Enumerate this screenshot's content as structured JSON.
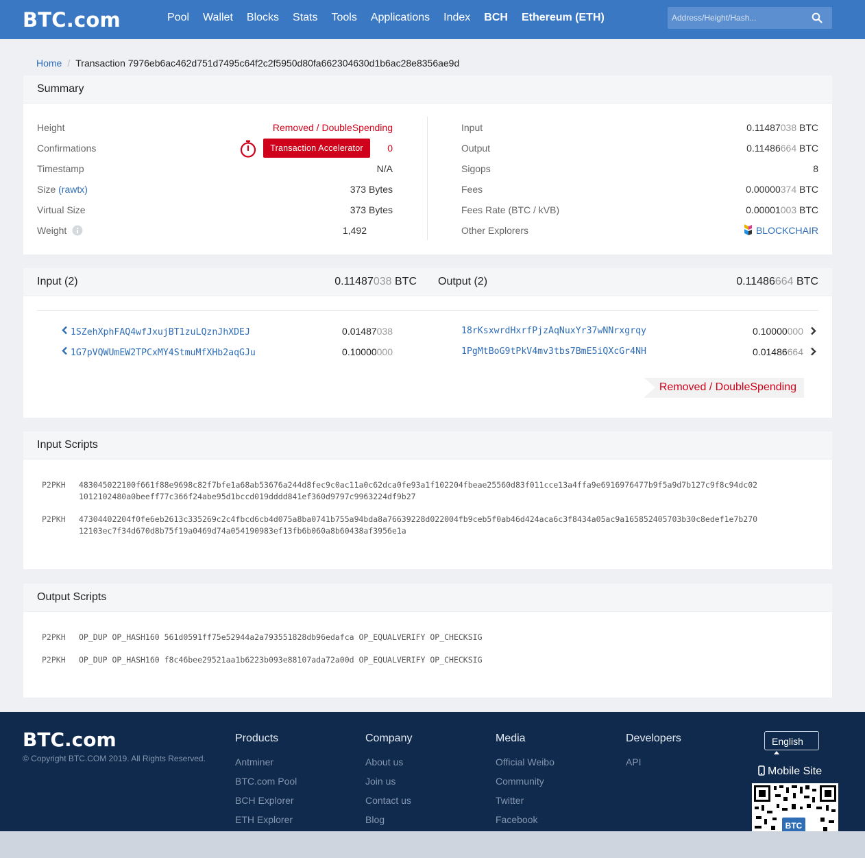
{
  "header": {
    "logo": "BTC.com",
    "nav": [
      "Pool",
      "Wallet",
      "Blocks",
      "Stats",
      "Tools",
      "Applications",
      "Index",
      "BCH",
      "Ethereum (ETH)"
    ],
    "search_placeholder": "Address/Height/Hash..."
  },
  "breadcrumb": {
    "home": "Home",
    "current": "Transaction 7976eb6ac462d751d7495c64f2c2f5950d80fa662304630d1b6ac28e8356ae9d"
  },
  "summary": {
    "title": "Summary",
    "left": [
      {
        "label": "Height",
        "value": "Removed / DoubleSpending"
      },
      {
        "label": "Confirmations",
        "value": "0"
      },
      {
        "label": "Timestamp",
        "value": "N/A"
      },
      {
        "label": "Size",
        "link": "(rawtx)",
        "value": "373 Bytes"
      },
      {
        "label": "Virtual Size",
        "value": "373 Bytes"
      },
      {
        "label": "Weight",
        "value": "1,492"
      }
    ],
    "accelerator_label": "Transaction Accelerator",
    "right": [
      {
        "label": "Input",
        "value_main": "0.11487",
        "value_light": "038",
        "unit": " BTC"
      },
      {
        "label": "Output",
        "value_main": "0.11486",
        "value_light": "664",
        "unit": " BTC"
      },
      {
        "label": "Sigops",
        "value": "8"
      },
      {
        "label": "Fees",
        "value_main": "0.00000",
        "value_light": "374",
        "unit": " BTC"
      },
      {
        "label": "Fees Rate (BTC / kVB)",
        "value_main": "0.00001",
        "value_light": "003",
        "unit": " BTC"
      },
      {
        "label": "Other Explorers",
        "value": "BLOCKCHAIR"
      }
    ]
  },
  "io": {
    "input_title": "Input (2)",
    "input_total_main": "0.11487",
    "input_total_light": "038",
    "output_title": "Output (2)",
    "output_total_main": "0.11486",
    "output_total_light": "664",
    "unit": " BTC",
    "inputs": [
      {
        "address": "1SZehXphFAQ4wfJxujBT1zuLQznJhXDEJ",
        "main": "0.01487",
        "light": "038"
      },
      {
        "address": "1G7pVQWUmEW2TPCxMY4StmuMfXHb2aqGJu",
        "main": "0.10000",
        "light": "000"
      }
    ],
    "outputs": [
      {
        "address": "18rKsxwrdHxrfPjzAqNuxYr37wNNrxgrqy",
        "main": "0.10000",
        "light": "000"
      },
      {
        "address": "1PgMtBoG9tPkV4mv3tbs7BmE5iQXcGr4NH",
        "main": "0.01486",
        "light": "664"
      }
    ],
    "status": "Removed / DoubleSpending"
  },
  "input_scripts": {
    "title": "Input Scripts",
    "items": [
      {
        "type": "P2PKH",
        "line1": "483045022100f661f88e9698c82f7bfe1a68ab53676a244d8fec9c0ac11a0c62dca0fe93a1f102204fbeae25560d83f011cce13a4ffa9e6916976477b9f5a9d7b127c9f8c94dc02",
        "line2": "1012102480a0beeff77c366f24abe95d1bccd019dddd841ef360d9797c9963224df9b27"
      },
      {
        "type": "P2PKH",
        "line1": "47304402204f0fe6eb2613c335269c2c4fbcd6cb4d075a8ba0741b755a94bda8a76639228d022004fb9ceb5f0ab46d424aca6c3f8434a05ac9a165852405703b30c8edef1e7b270",
        "line2": "12103ec7f34d670d8b75f19a0469d74a054190983ef13fb6b060a8b60438af3956e1a"
      }
    ]
  },
  "output_scripts": {
    "title": "Output Scripts",
    "items": [
      {
        "type": "P2PKH",
        "script": "OP_DUP OP_HASH160 561d0591ff75e52944a2a793551828db96edafca OP_EQUALVERIFY OP_CHECKSIG"
      },
      {
        "type": "P2PKH",
        "script": "OP_DUP OP_HASH160 f8c46bee29521aa1b6223b093e88107ada72a00d OP_EQUALVERIFY OP_CHECKSIG"
      }
    ]
  },
  "footer": {
    "logo": "BTC.com",
    "copyright": "© Copyright BTC.COM 2019. All Rights Reserved.",
    "columns": [
      {
        "title": "Products",
        "items": [
          "Antminer",
          "BTC.com Pool",
          "BCH Explorer",
          "ETH Explorer"
        ]
      },
      {
        "title": "Company",
        "items": [
          "About us",
          "Join us",
          "Contact us",
          "Blog"
        ]
      },
      {
        "title": "Media",
        "items": [
          "Official Weibo",
          "Community",
          "Twitter",
          "Facebook"
        ]
      },
      {
        "title": "Developers",
        "items": [
          "API"
        ]
      }
    ],
    "language": "English",
    "mobile": "Mobile Site"
  },
  "colors": {
    "header_blue": "#3a78c4",
    "footer_navy": "#0f2a4d",
    "accent_red": "#d0021b",
    "link_blue": "#2f6db5"
  }
}
